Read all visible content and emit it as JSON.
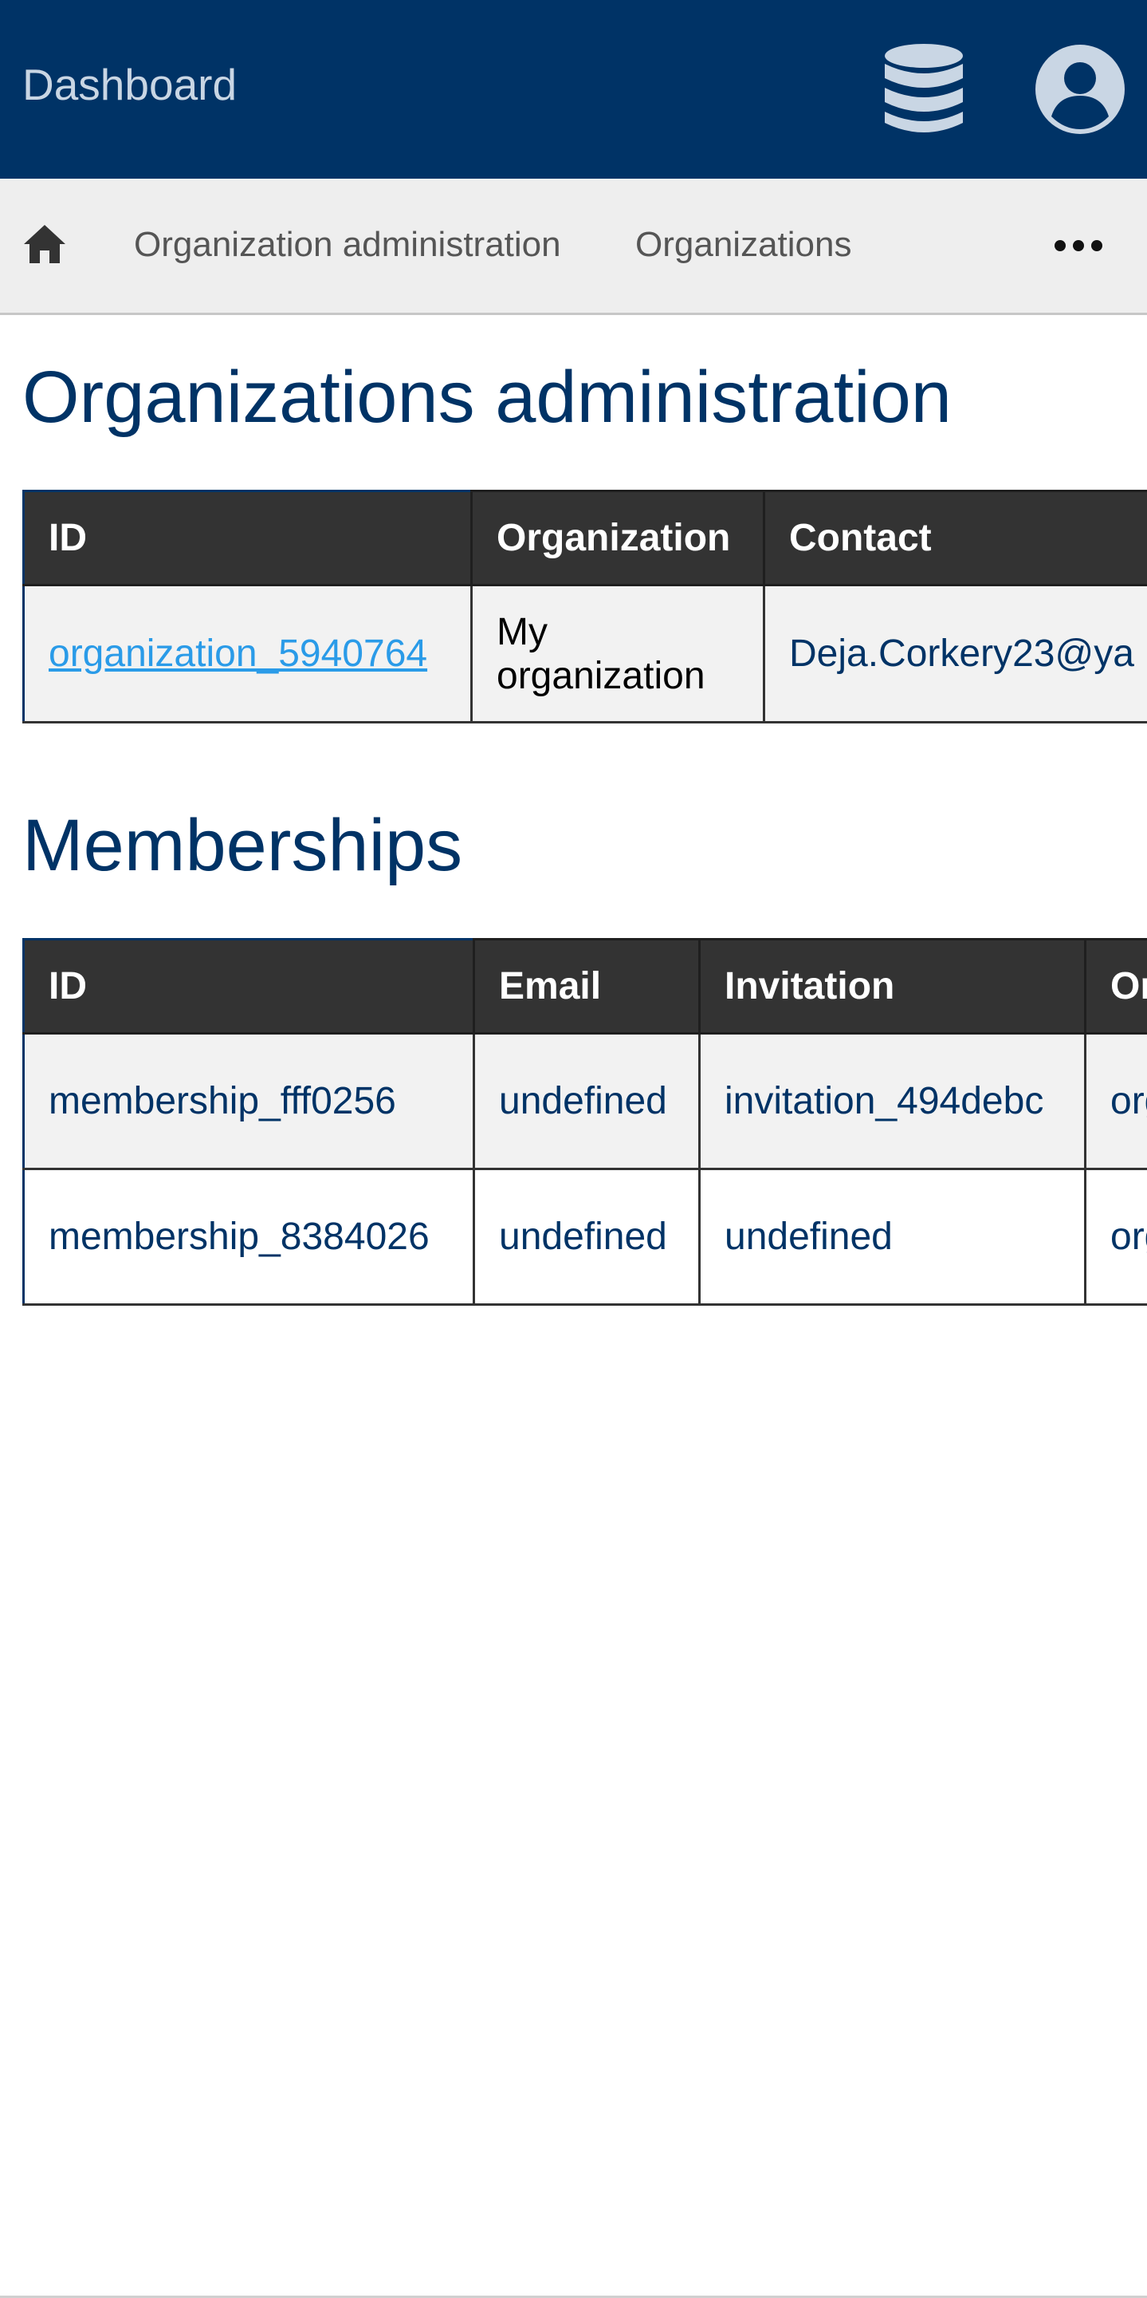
{
  "header": {
    "title": "Dashboard",
    "database_icon": "database-icon",
    "account_icon": "user-circle-icon",
    "background_color": "#003366"
  },
  "breadcrumb": {
    "home_icon": "home-icon",
    "items": [
      {
        "label": "Organization administration"
      },
      {
        "label": "Organizations"
      }
    ],
    "more_icon": "more-horizontal-icon"
  },
  "organizations": {
    "heading": "Organizations administration",
    "columns": [
      "ID",
      "Organization",
      "Contact"
    ],
    "rows": [
      {
        "id": "organization_5940764",
        "organization": "My organization",
        "contact": "Deja.Corkery23@ya"
      }
    ]
  },
  "memberships": {
    "heading": "Memberships",
    "columns": [
      "ID",
      "Email",
      "Invitation",
      "Or"
    ],
    "rows": [
      {
        "id": "membership_fff0256",
        "email": "undefined",
        "invitation": "invitation_494debc",
        "org": "org"
      },
      {
        "id": "membership_8384026",
        "email": "undefined",
        "invitation": "undefined",
        "org": "org"
      }
    ]
  },
  "colors": {
    "primary": "#003366",
    "table_header": "#333333",
    "link": "#2a9be8",
    "breadcrumb_bg": "#eeeeee"
  }
}
